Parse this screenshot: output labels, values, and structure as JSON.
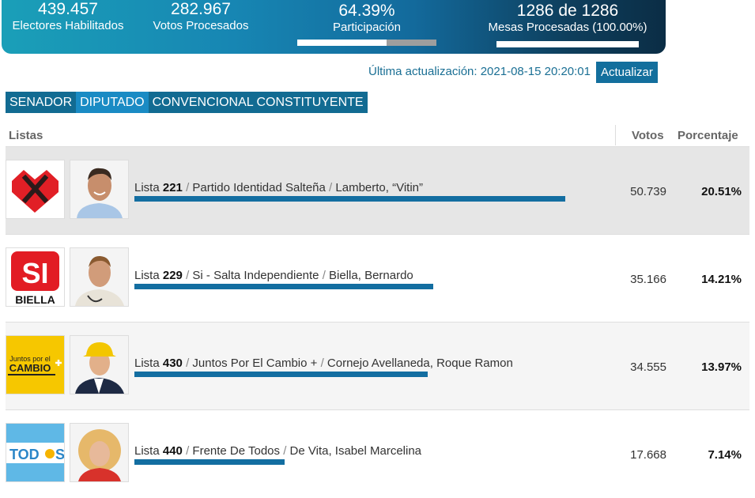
{
  "header": {
    "electores": {
      "value": "439.457",
      "label": "Electores Habilitados"
    },
    "votos": {
      "value": "282.967",
      "label": "Votos Procesados"
    },
    "participacion": {
      "value": "64.39%",
      "label": "Participación",
      "fraction": 0.6439
    },
    "mesas": {
      "value": "1286 de 1286",
      "label": "Mesas Procesadas (100.00%)",
      "fraction": 1.0
    }
  },
  "update": {
    "text": "Última actualización: 2021-08-15 20:20:01",
    "button": "Actualizar"
  },
  "tabs": [
    {
      "label": "SENADOR",
      "active": false
    },
    {
      "label": "DIPUTADO",
      "active": true
    },
    {
      "label": "CONVENCIONAL CONSTITUYENTE",
      "active": false
    }
  ],
  "table": {
    "headers": {
      "lists": "Listas",
      "votes": "Votos",
      "percent": "Porcentaje"
    },
    "rows": [
      {
        "list_prefix": "Lista",
        "list_number": "221",
        "party": "Partido Identidad Salteña",
        "candidate": "Lamberto, “Vitin”",
        "votes": "50.739",
        "percent": "20.51%",
        "fraction": 1.0,
        "logo": "identidad-salteña-logo"
      },
      {
        "list_prefix": "Lista",
        "list_number": "229",
        "party": "Si - Salta Independiente",
        "candidate": "Biella, Bernardo",
        "votes": "35.166",
        "percent": "14.21%",
        "fraction": 0.693,
        "logo": "si-biella-logo",
        "logo_text": "SI",
        "logo_subtext": "BIELLA"
      },
      {
        "list_prefix": "Lista",
        "list_number": "430",
        "party": "Juntos Por El Cambio +",
        "candidate": "Cornejo Avellaneda, Roque Ramon",
        "votes": "34.555",
        "percent": "13.97%",
        "fraction": 0.681,
        "logo": "juntos-por-el-cambio-logo",
        "logo_text": "Juntos por el",
        "logo_subtext": "CAMBIO"
      },
      {
        "list_prefix": "Lista",
        "list_number": "440",
        "party": "Frente De Todos",
        "candidate": "De Vita, Isabel Marcelina",
        "votes": "17.668",
        "percent": "7.14%",
        "fraction": 0.348,
        "logo": "frente-de-todos-logo",
        "logo_text": "TOD",
        "logo_subtext": "S"
      }
    ]
  },
  "colors": {
    "accent": "#136ea1",
    "banner_start": "#1a9fb8",
    "banner_end": "#0b2d45",
    "tab_active": "#1a8bc4",
    "tab": "#126b92"
  }
}
